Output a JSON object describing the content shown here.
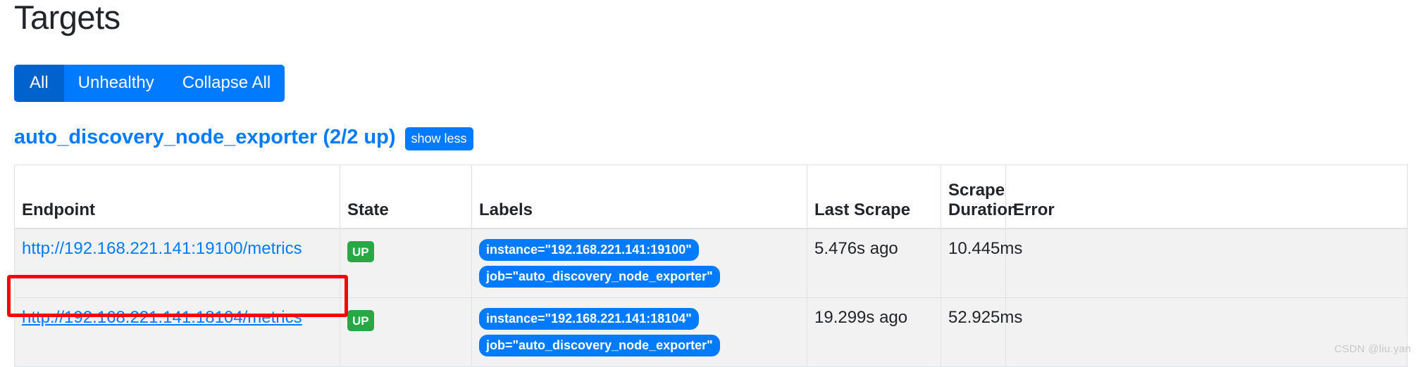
{
  "page": {
    "title": "Targets",
    "watermark": "CSDN @liu.yan"
  },
  "filter_buttons": [
    {
      "label": "All",
      "active": true
    },
    {
      "label": "Unhealthy",
      "active": false
    },
    {
      "label": "Collapse All",
      "active": false
    }
  ],
  "job": {
    "title": "auto_discovery_node_exporter (2/2 up)",
    "toggle_label": "show less",
    "name": "auto_discovery_node_exporter",
    "up_count": "2",
    "total_count": "2"
  },
  "table": {
    "headers": {
      "endpoint": "Endpoint",
      "state": "State",
      "labels": "Labels",
      "last_scrape": "Last Scrape",
      "scrape_duration": "Scrape Duration",
      "error": "Error"
    },
    "rows": [
      {
        "endpoint": "http://192.168.221.141:19100/metrics",
        "state": "UP",
        "labels": [
          "instance=\"192.168.221.141:19100\"",
          "job=\"auto_discovery_node_exporter\""
        ],
        "last_scrape": "5.476s ago",
        "scrape_duration": "10.445ms",
        "error": ""
      },
      {
        "endpoint": "http://192.168.221.141:18104/metrics",
        "state": "UP",
        "labels": [
          "instance=\"192.168.221.141:18104\"",
          "job=\"auto_discovery_node_exporter\""
        ],
        "last_scrape": "19.299s ago",
        "scrape_duration": "52.925ms",
        "error": ""
      }
    ]
  },
  "colors": {
    "primary": "#007bff",
    "primary_active": "#0062cc",
    "success": "#28a745",
    "annotation": "#ff0000",
    "row_background": "#f2f2f2",
    "border": "#dee2e6"
  }
}
